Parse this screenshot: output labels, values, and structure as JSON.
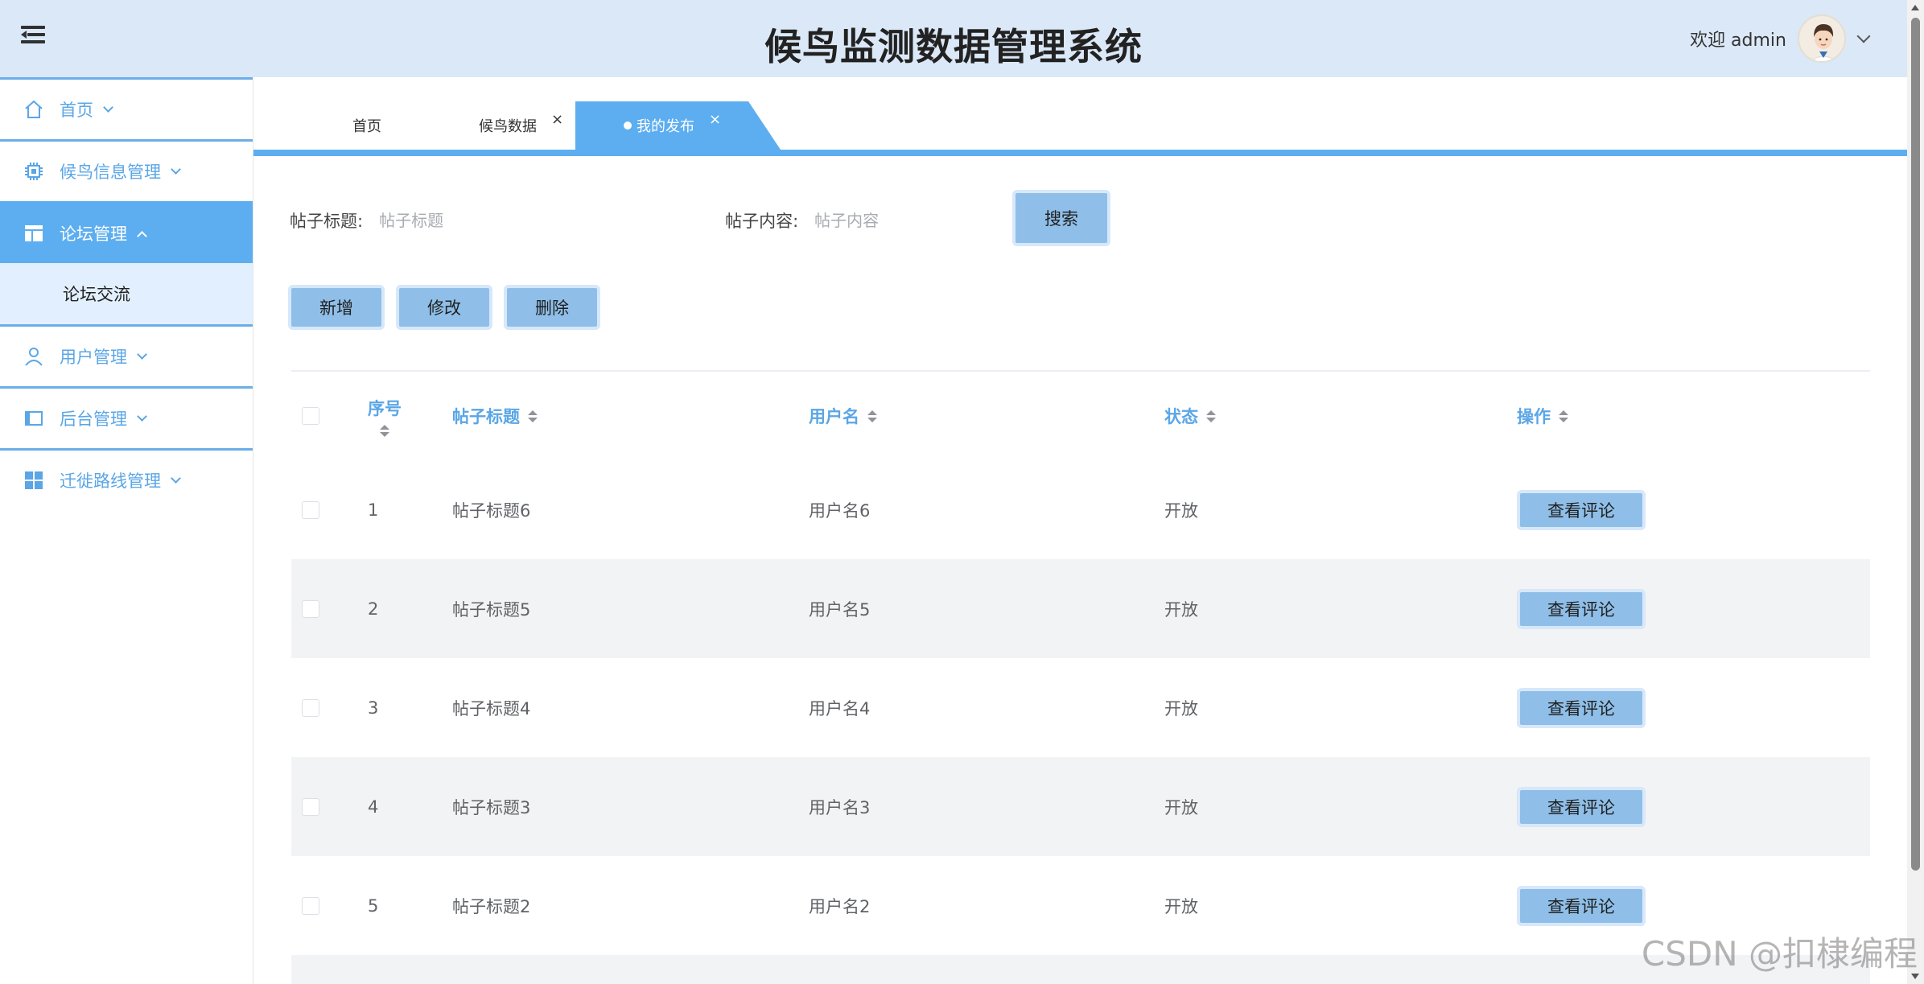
{
  "header": {
    "title": "候鸟监测数据管理系统",
    "welcome": "欢迎 admin"
  },
  "sidebar": {
    "items": [
      {
        "label": "首页",
        "icon": "home-icon"
      },
      {
        "label": "候鸟信息管理",
        "icon": "chip-icon"
      },
      {
        "label": "论坛管理",
        "icon": "layout-icon",
        "active": true
      },
      {
        "label": "用户管理",
        "icon": "user-icon"
      },
      {
        "label": "后台管理",
        "icon": "panel-icon"
      },
      {
        "label": "迁徙路线管理",
        "icon": "grid-icon"
      }
    ],
    "submenu": {
      "label": "论坛交流"
    }
  },
  "tabs": [
    {
      "label": "首页"
    },
    {
      "label": "候鸟数据",
      "close": "×"
    },
    {
      "label": "我的发布",
      "close": "×",
      "active": true
    }
  ],
  "search": {
    "title_label": "帖子标题:",
    "title_placeholder": "帖子标题",
    "content_label": "帖子内容:",
    "content_placeholder": "帖子内容",
    "search_button": "搜索"
  },
  "actions": {
    "add": "新增",
    "edit": "修改",
    "delete": "删除"
  },
  "table": {
    "headers": {
      "seq": "序号",
      "title": "帖子标题",
      "user": "用户名",
      "status": "状态",
      "op": "操作"
    },
    "rows": [
      {
        "seq": "1",
        "title": "帖子标题6",
        "user": "用户名6",
        "status": "开放",
        "op": "查看评论"
      },
      {
        "seq": "2",
        "title": "帖子标题5",
        "user": "用户名5",
        "status": "开放",
        "op": "查看评论"
      },
      {
        "seq": "3",
        "title": "帖子标题4",
        "user": "用户名4",
        "status": "开放",
        "op": "查看评论"
      },
      {
        "seq": "4",
        "title": "帖子标题3",
        "user": "用户名3",
        "status": "开放",
        "op": "查看评论"
      },
      {
        "seq": "5",
        "title": "帖子标题2",
        "user": "用户名2",
        "status": "开放",
        "op": "查看评论"
      }
    ]
  },
  "watermark": "CSDN @扣棣编程",
  "colors": {
    "accent": "#5caef0",
    "header_bg": "#dbe8f7",
    "button_bg": "#8fbfe8",
    "link_text": "#5aa6e6"
  }
}
